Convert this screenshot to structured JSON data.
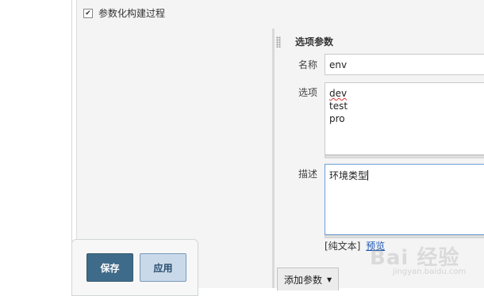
{
  "param_checkbox": {
    "checked": "✔",
    "label": "参数化构建过程"
  },
  "choice_param": {
    "title": "选项参数",
    "name_label": "名称",
    "name_value": "env",
    "choices_label": "选项",
    "choices": [
      "dev",
      "test",
      "pro"
    ],
    "description_label": "描述",
    "description_value": "环境类型",
    "plain_text": "[纯文本]",
    "preview": "预览"
  },
  "add_param_button": "添加参数",
  "buttons": {
    "save": "保存",
    "apply": "应用"
  },
  "watermark": {
    "brand": "Bai 经验",
    "url": "jingyan.baidu.com"
  },
  "colors": {
    "save_bg": "#3f6b8a",
    "apply_bg": "#c9d9ea",
    "focus_border": "#6a9fd4",
    "link": "#1a55b5"
  }
}
